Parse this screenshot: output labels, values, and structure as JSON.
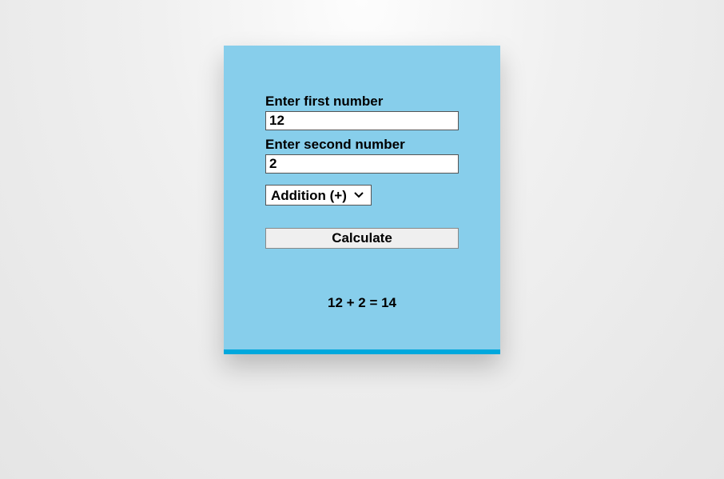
{
  "form": {
    "first_label": "Enter first number",
    "first_value": "12",
    "second_label": "Enter second number",
    "second_value": "2",
    "operation_selected": "Addition (+)",
    "calculate_label": "Calculate"
  },
  "result_text": "12 + 2 = 14"
}
